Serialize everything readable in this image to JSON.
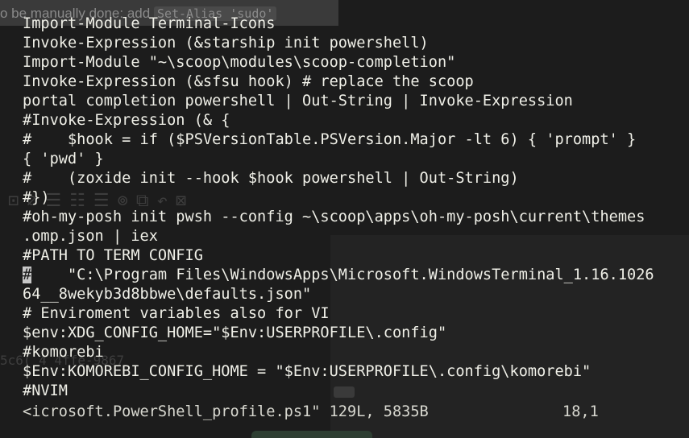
{
  "background": {
    "hint_text": "o be manually done: add",
    "hint_code": "Set-Alias 'sudo'",
    "hash_fragment": "5c6(   4     4ffe-9867"
  },
  "colors": {
    "background": "#1c1c1c",
    "text": "#f0f0e8",
    "cursor": "#c8c8c8"
  },
  "buffer": {
    "lines": [
      "Import-Module Terminal-Icons",
      "Invoke-Expression (&starship init powershell)",
      "Import-Module \"~\\scoop\\modules\\scoop-completion\"",
      "Invoke-Expression (&sfsu hook) # replace the scoop",
      "portal completion powershell | Out-String | Invoke-Expression",
      "#Invoke-Expression (& {",
      "#    $hook = if ($PSVersionTable.PSVersion.Major -lt 6) { 'prompt' }",
      "{ 'pwd' }",
      "#    (zoxide init --hook $hook powershell | Out-String)",
      "#})",
      "#oh-my-posh init pwsh --config ~\\scoop\\apps\\oh-my-posh\\current\\themes",
      ".omp.json | iex",
      "#PATH TO TERM CONFIG",
      "    \"C:\\Program Files\\WindowsApps\\Microsoft.WindowsTerminal_1.16.1026",
      "64__8wekyb3d8bbwe\\defaults.json\"",
      "# Enviroment variables also for VI",
      "$env:XDG_CONFIG_HOME=\"$Env:USERPROFILE\\.config\"",
      "#komorebi",
      "$Env:KOMOREBI_CONFIG_HOME = \"$Env:USERPROFILE\\.config\\komorebi\"",
      "#NVIM"
    ],
    "cursor_char": "#"
  },
  "statusline": {
    "file": "<icrosoft.PowerShell_profile.ps1\" 129L, 5835B",
    "position": "18,1"
  }
}
